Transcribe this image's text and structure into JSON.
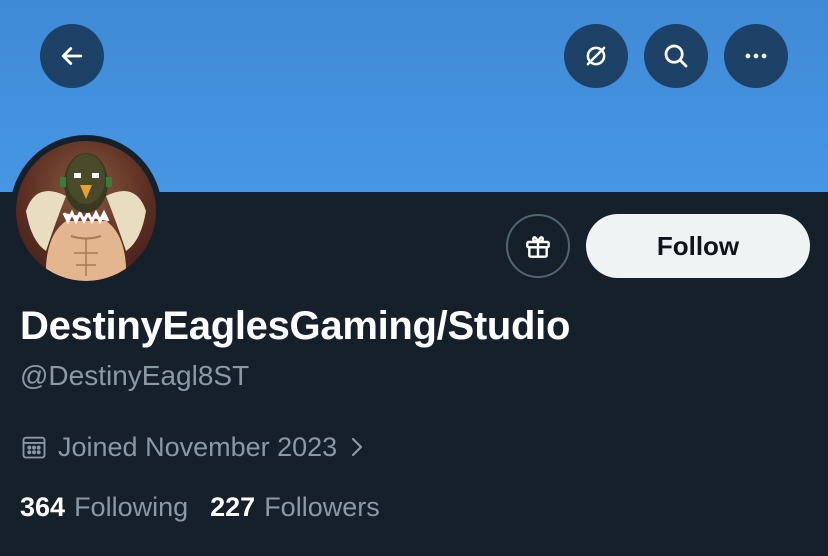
{
  "profile": {
    "display_name": "DestinyEaglesGaming/Studio",
    "handle": "@DestinyEagl8ST",
    "joined": "Joined November 2023",
    "following_count": "364",
    "following_label": "Following",
    "followers_count": "227",
    "followers_label": "Followers"
  },
  "actions": {
    "follow_label": "Follow"
  },
  "icons": {
    "back": "arrow-left-icon",
    "unmute": "bell-slash-icon",
    "search": "search-icon",
    "more": "more-horizontal-icon",
    "gift": "gift-icon",
    "calendar": "calendar-icon",
    "chevron": "chevron-right-icon"
  },
  "colors": {
    "banner": "#4696e4",
    "background": "#15202b",
    "follow_button_bg": "#eff3f4",
    "secondary_text": "#8b98a5"
  }
}
